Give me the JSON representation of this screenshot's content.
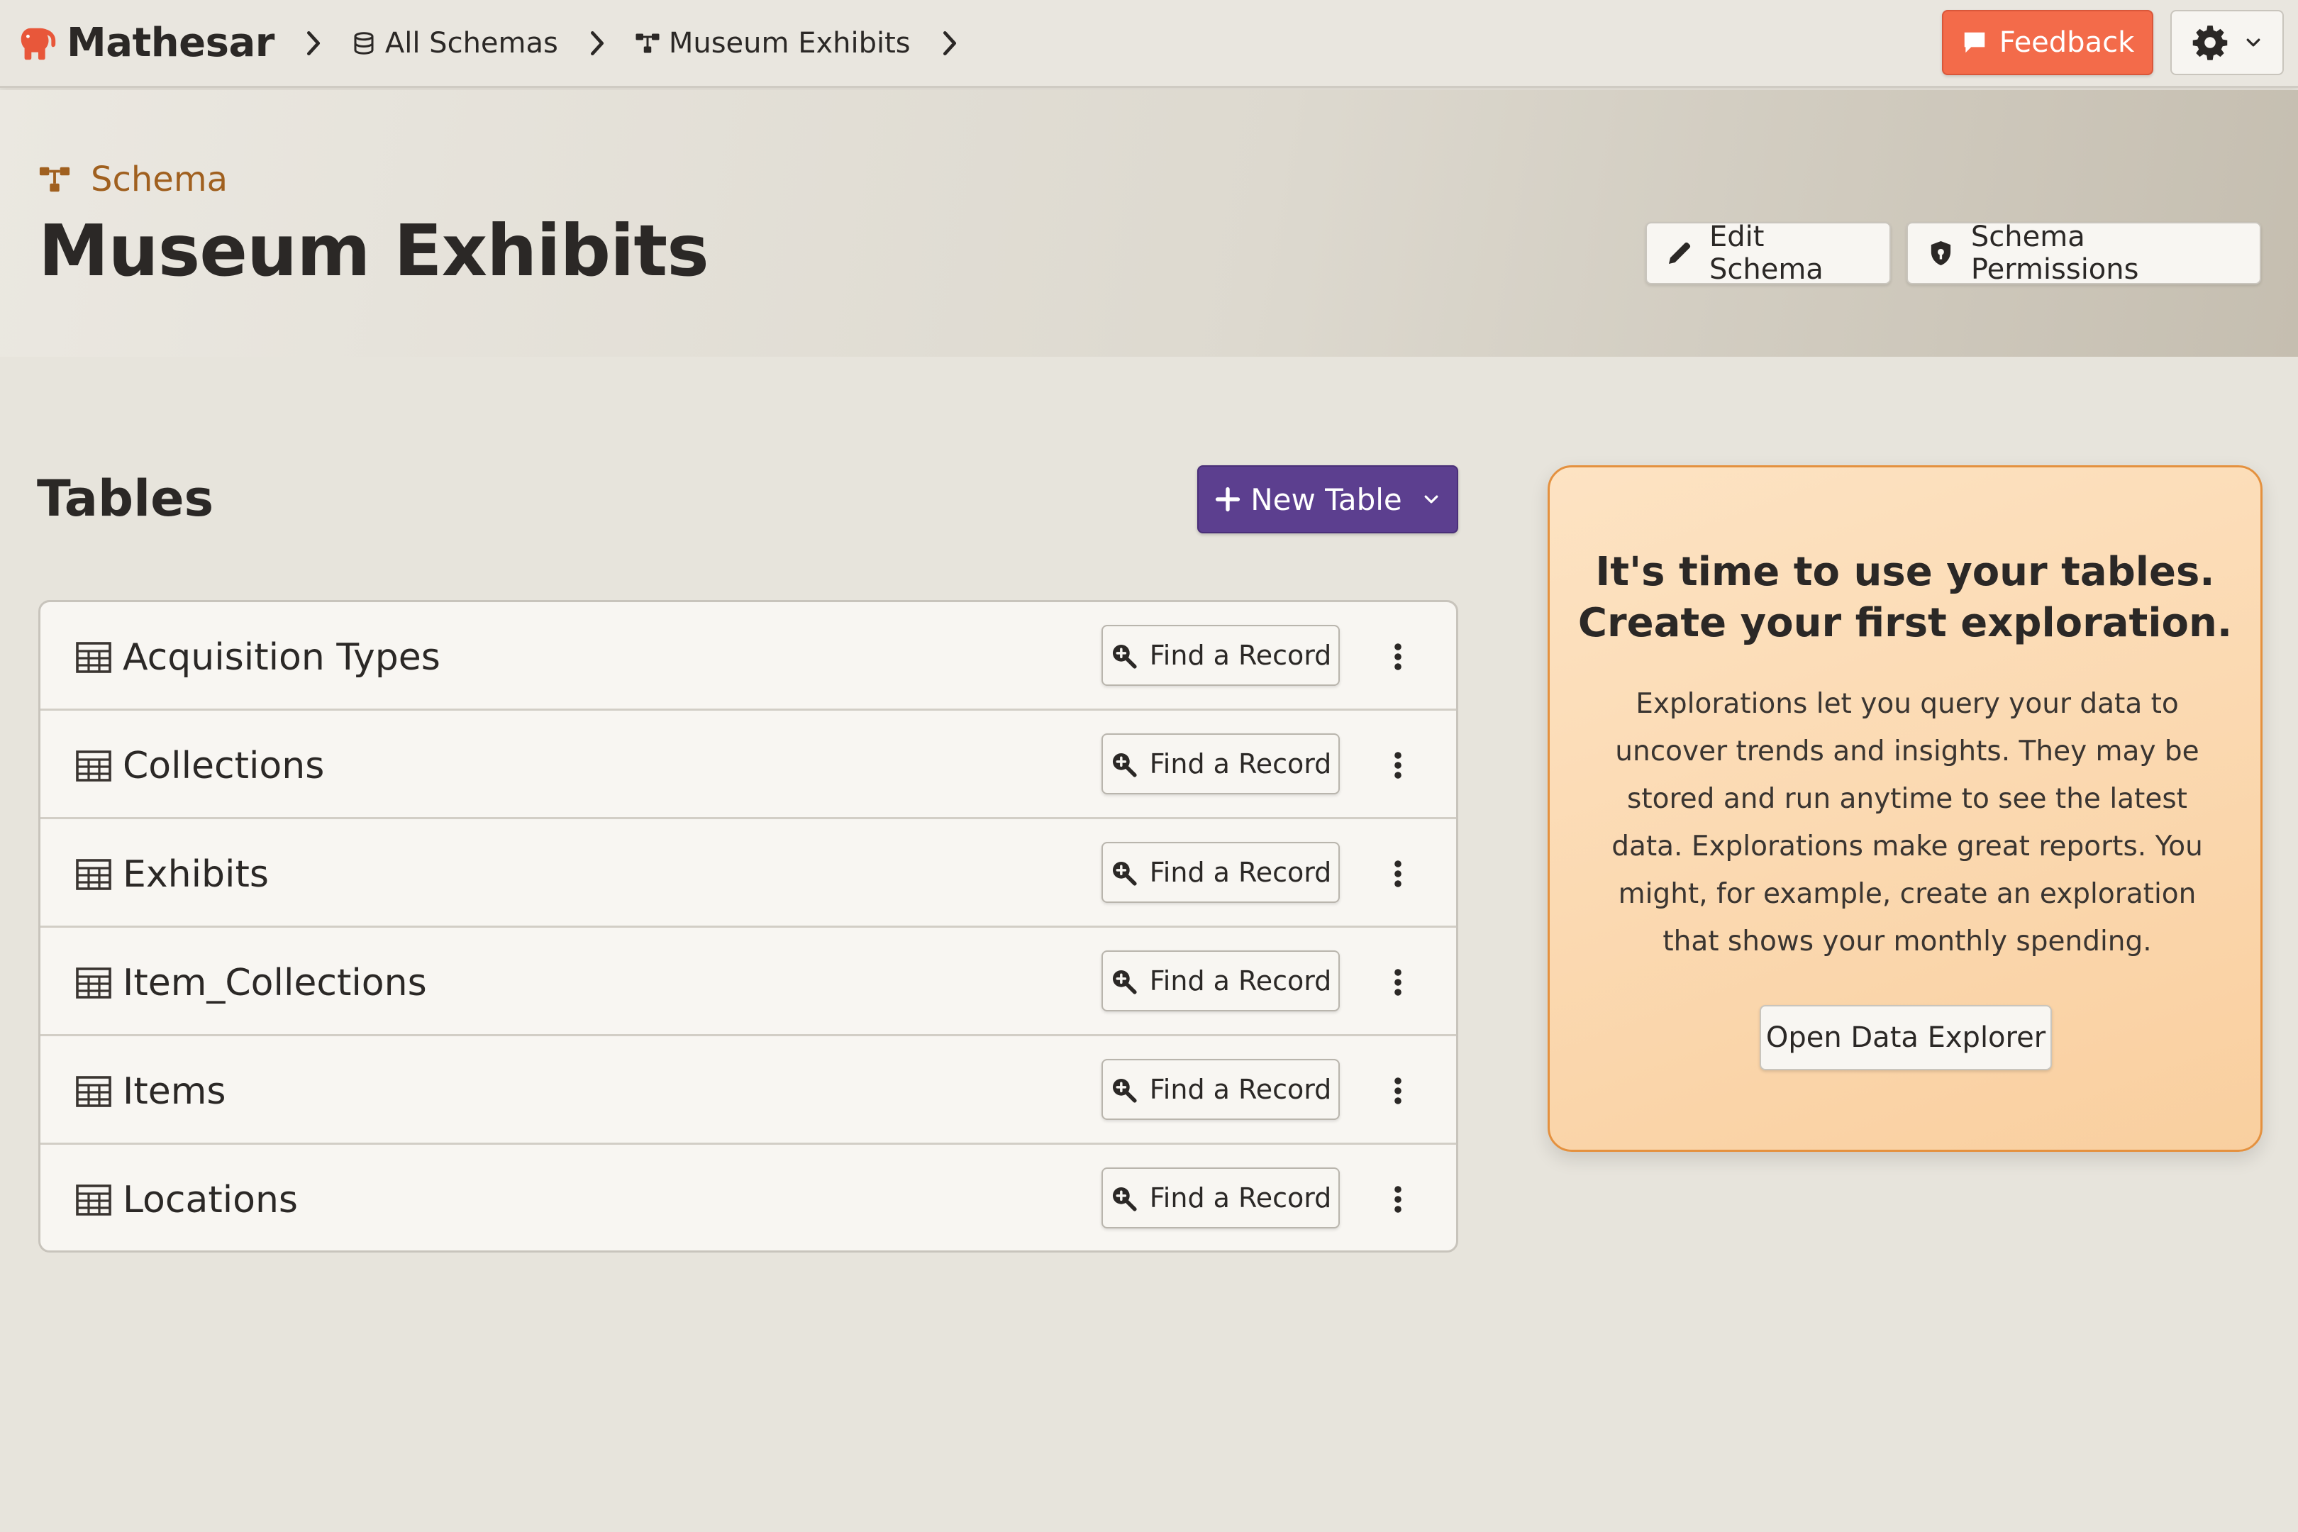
{
  "app": {
    "name": "Mathesar",
    "logo_icon": "elephant-logo-icon",
    "brand_color": "#e8573a"
  },
  "breadcrumbs": [
    {
      "label": "All Schemas",
      "icon": "database-icon"
    },
    {
      "label": "Museum Exhibits",
      "icon": "schema-icon"
    }
  ],
  "topbar": {
    "feedback_label": "Feedback",
    "feedback_color": "#f36b4a",
    "settings_icon": "gear-icon"
  },
  "header": {
    "eyebrow": "Schema",
    "title": "Museum Exhibits",
    "edit_label": "Edit Schema",
    "permissions_label": "Schema Permissions"
  },
  "tables_section": {
    "heading": "Tables",
    "new_table_label": "New Table",
    "new_table_color": "#5c3f8f",
    "find_label": "Find a Record",
    "rows": [
      {
        "name": "Acquisition Types"
      },
      {
        "name": "Collections"
      },
      {
        "name": "Exhibits"
      },
      {
        "name": "Item_Collections"
      },
      {
        "name": "Items"
      },
      {
        "name": "Locations"
      }
    ]
  },
  "exploration_card": {
    "title_line1": "It's time to use your tables.",
    "title_line2": "Create your first exploration.",
    "body": "Explorations let you query your data to uncover trends and insights. They may be stored and run anytime to see the latest data. Explorations make great reports. You might, for example, create an exploration that shows your monthly spending.",
    "button_label": "Open Data Explorer"
  }
}
